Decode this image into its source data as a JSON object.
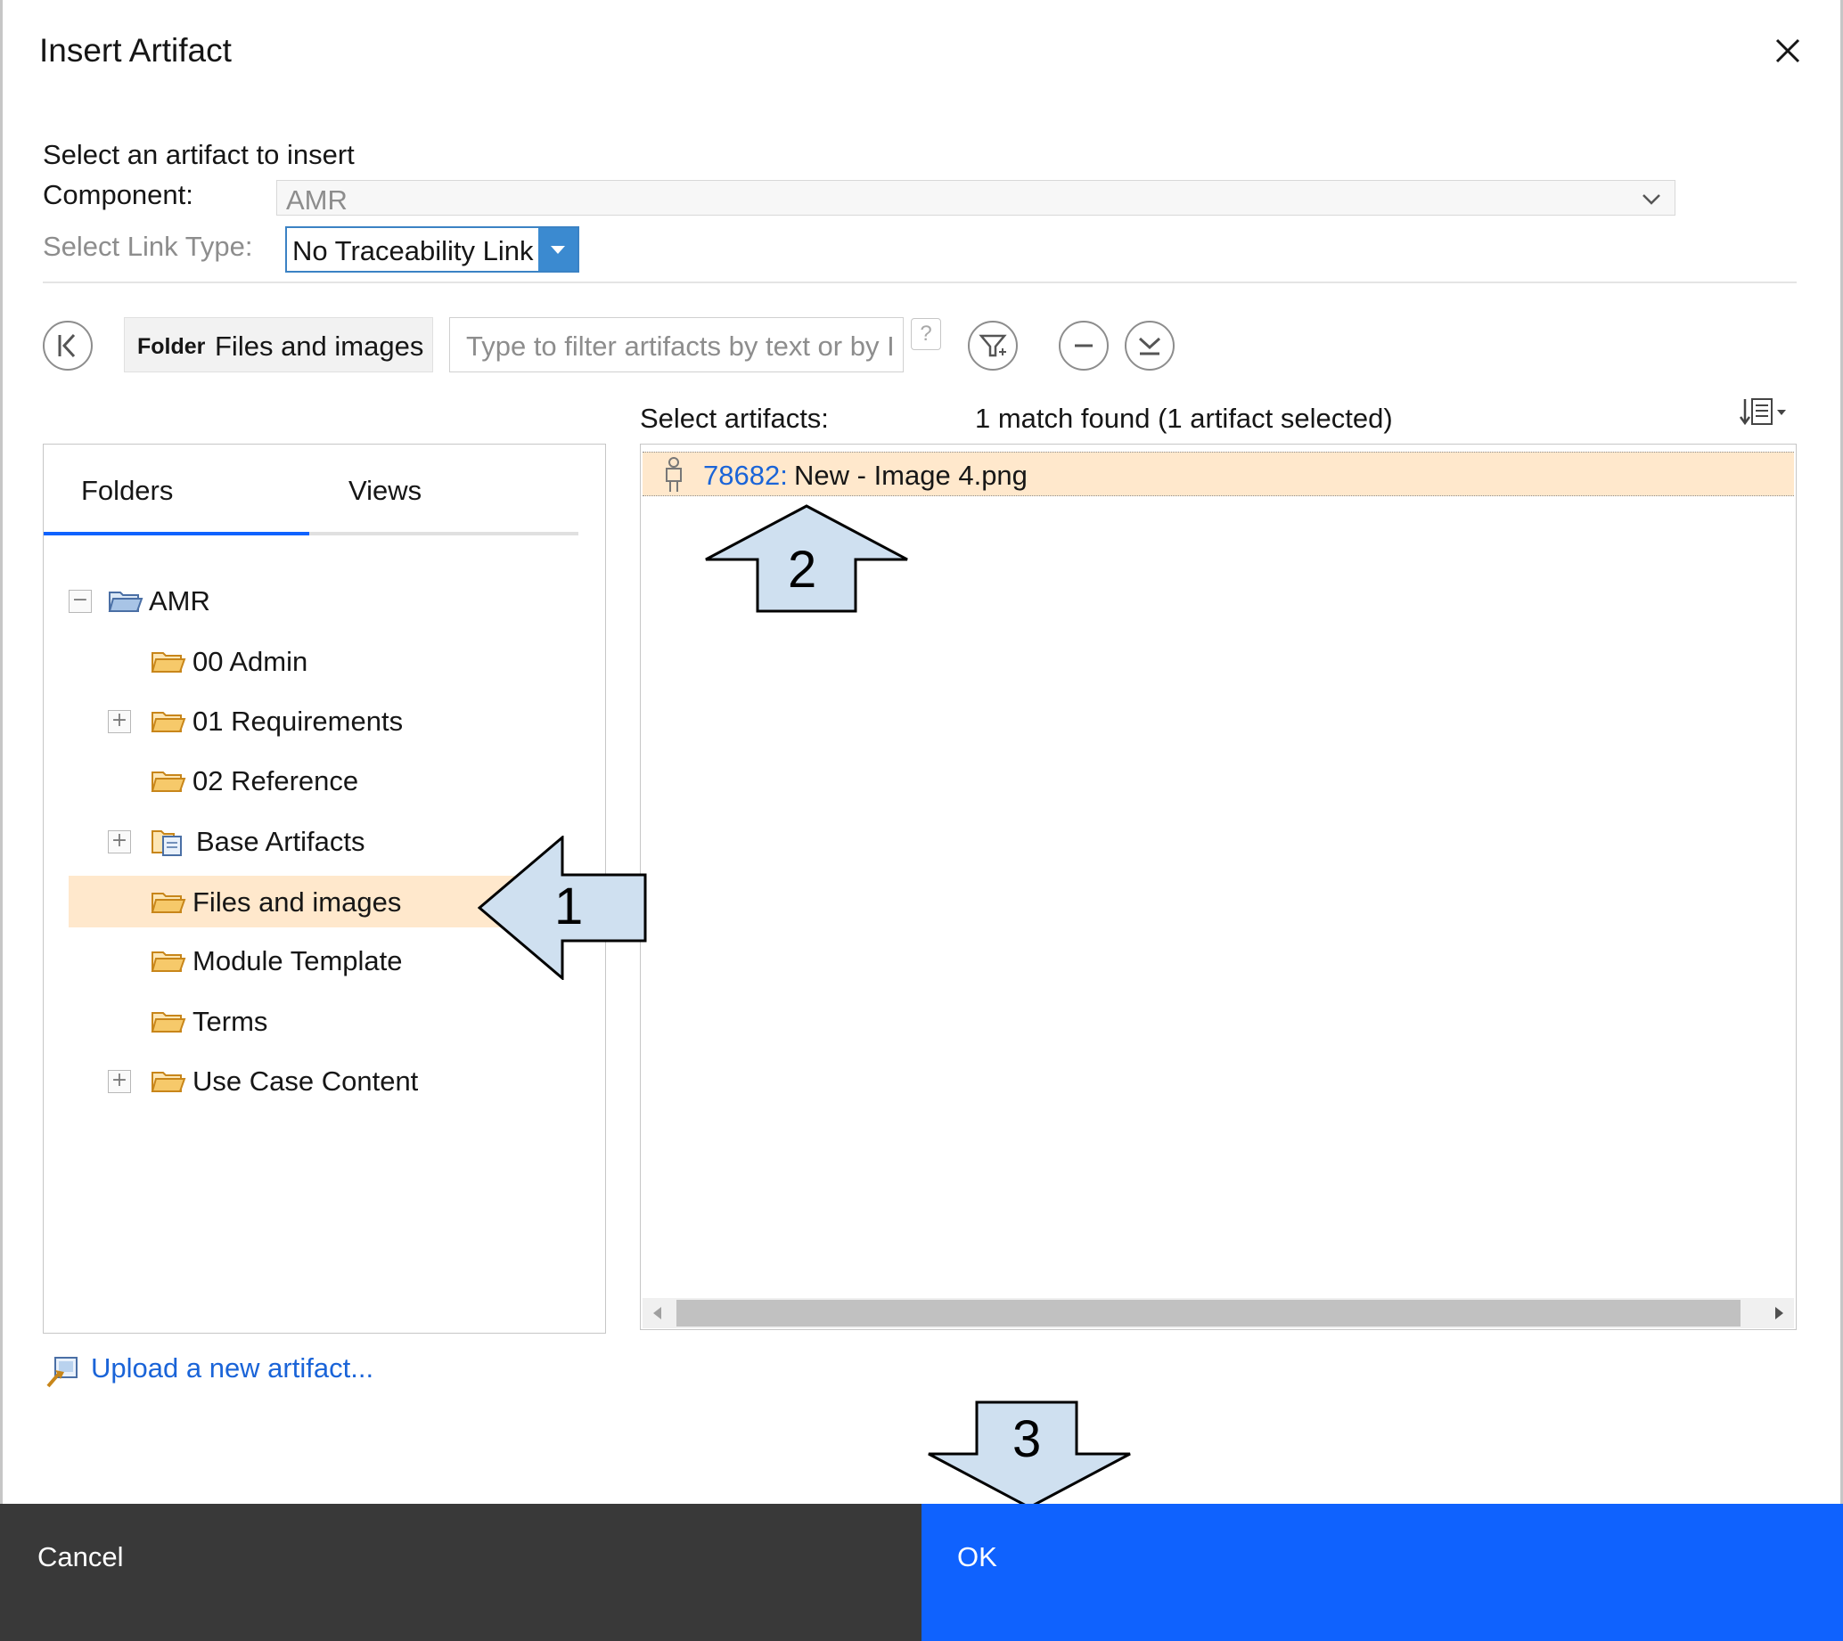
{
  "dialog": {
    "title": "Insert Artifact",
    "subtitle": "Select an artifact to insert",
    "component_label": "Component:",
    "component_value": "AMR",
    "link_type_label": "Select Link Type:",
    "link_type_value": "No Traceability Link"
  },
  "toolbar": {
    "folder_kind": "Folder",
    "folder_name": "Files and images",
    "filter_placeholder": "Type to filter artifacts by text or by I",
    "help_glyph": "?"
  },
  "tabs": {
    "folders": "Folders",
    "views": "Views"
  },
  "tree": {
    "root": "AMR",
    "items": [
      {
        "label": "00 Admin"
      },
      {
        "label": "01 Requirements"
      },
      {
        "label": "02 Reference"
      },
      {
        "label": "Base Artifacts"
      },
      {
        "label": "Files and images"
      },
      {
        "label": "Module Template"
      },
      {
        "label": "Terms"
      },
      {
        "label": "Use Case Content"
      }
    ],
    "expander_collapsed": "+",
    "expander_expanded": "−"
  },
  "results": {
    "select_label": "Select artifacts:",
    "match_text": "1 match found (1 artifact selected)",
    "artifact": {
      "id": "78682:",
      "name": "New - Image 4.png"
    }
  },
  "upload_link": "Upload a new artifact...",
  "callouts": {
    "one": "1",
    "two": "2",
    "three": "3"
  },
  "footer": {
    "cancel": "Cancel",
    "ok": "OK"
  },
  "colors": {
    "accent": "#0f62fe",
    "selection": "#ffe8cc",
    "link": "#1a64d8",
    "footer_dark": "#393939",
    "callout_fill": "#cfe0f0"
  }
}
